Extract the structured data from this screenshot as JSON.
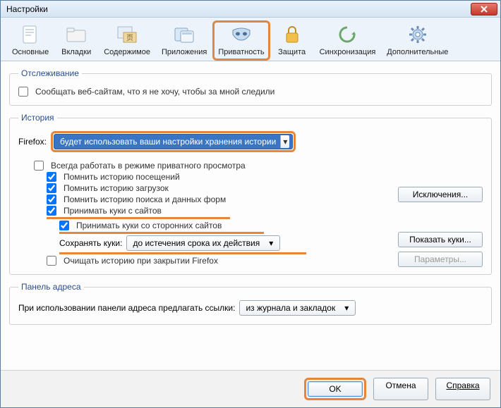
{
  "window": {
    "title": "Настройки"
  },
  "tabs": {
    "general": "Основные",
    "tabs": "Вкладки",
    "content": "Содержимое",
    "apps": "Приложения",
    "privacy": "Приватность",
    "security": "Защита",
    "sync": "Синхронизация",
    "advanced": "Дополнительные"
  },
  "tracking": {
    "legend": "Отслеживание",
    "dnt": "Сообщать веб-сайтам, что я не хочу, чтобы за мной следили"
  },
  "history": {
    "legend": "История",
    "firefox_label": "Firefox:",
    "mode_selected": "будет использовать ваши настройки хранения истории",
    "always_private": "Всегда работать в режиме приватного просмотра",
    "remember_browsing": "Помнить историю посещений",
    "remember_downloads": "Помнить историю загрузок",
    "remember_search": "Помнить историю поиска и данных форм",
    "accept_cookies": "Принимать куки с сайтов",
    "accept_thirdparty": "Принимать куки со сторонних сайтов",
    "keep_label": "Сохранять куки:",
    "keep_selected": "до истечения срока их действия",
    "clear_on_close": "Очищать историю при закрытии Firefox",
    "btn_exceptions": "Исключения...",
    "btn_show_cookies": "Показать куки...",
    "btn_settings": "Параметры..."
  },
  "addressbar": {
    "legend": "Панель адреса",
    "label": "При использовании панели адреса предлагать ссылки:",
    "selected": "из журнала и закладок"
  },
  "buttons": {
    "ok": "OK",
    "cancel": "Отмена",
    "help": "Справка"
  }
}
